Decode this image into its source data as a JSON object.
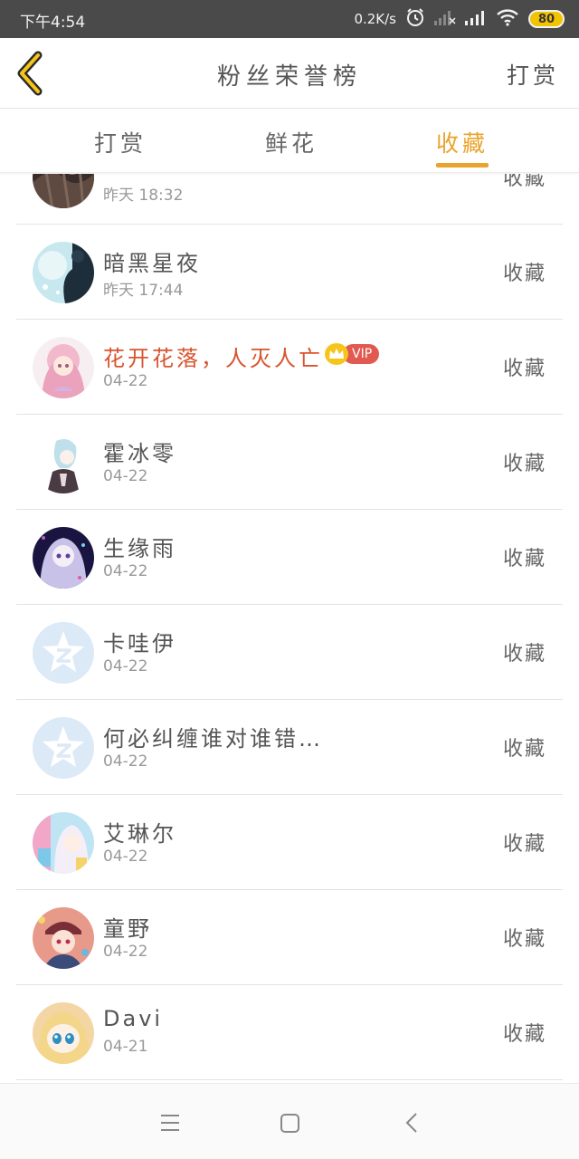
{
  "status_bar": {
    "time": "下午4:54",
    "net_speed": "0.2K/s",
    "battery": "80"
  },
  "header": {
    "title": "粉丝荣誉榜",
    "reward_label": "打赏"
  },
  "tabs": [
    {
      "label": "打赏",
      "active": false
    },
    {
      "label": "鲜花",
      "active": false
    },
    {
      "label": "收藏",
      "active": true
    }
  ],
  "colors": {
    "accent": "#eaa32c",
    "vip_name": "#d9542f",
    "vip_badge": "#e05a52"
  },
  "fans": [
    {
      "name": "",
      "time": "昨天 18:32",
      "action": "收藏",
      "avatar": "dark-artwork"
    },
    {
      "name": "暗黑星夜",
      "time": "昨天 17:44",
      "action": "收藏",
      "avatar": "blue-sky-artwork"
    },
    {
      "name": "花开花落，人灭人亡",
      "time": "04-22",
      "action": "收藏",
      "avatar": "pink-anime-girl",
      "vip": true,
      "vip_label": "VIP"
    },
    {
      "name": "霍冰零",
      "time": "04-22",
      "action": "收藏",
      "avatar": "anime-sketch"
    },
    {
      "name": "生缘雨",
      "time": "04-22",
      "action": "收藏",
      "avatar": "purple-anime-girl"
    },
    {
      "name": "卡哇伊",
      "time": "04-22",
      "action": "收藏",
      "avatar": "default-star"
    },
    {
      "name": "何必纠缠谁对谁错…",
      "time": "04-22",
      "action": "收藏",
      "avatar": "default-star"
    },
    {
      "name": "艾琳尔",
      "time": "04-22",
      "action": "收藏",
      "avatar": "pastel-anime-girl"
    },
    {
      "name": "童野",
      "time": "04-22",
      "action": "收藏",
      "avatar": "anime-boy"
    },
    {
      "name": "Davi",
      "time": "04-21",
      "action": "收藏",
      "avatar": "blonde-anime-girl"
    }
  ],
  "nav": [
    "menu-icon",
    "home-icon",
    "back-icon"
  ]
}
